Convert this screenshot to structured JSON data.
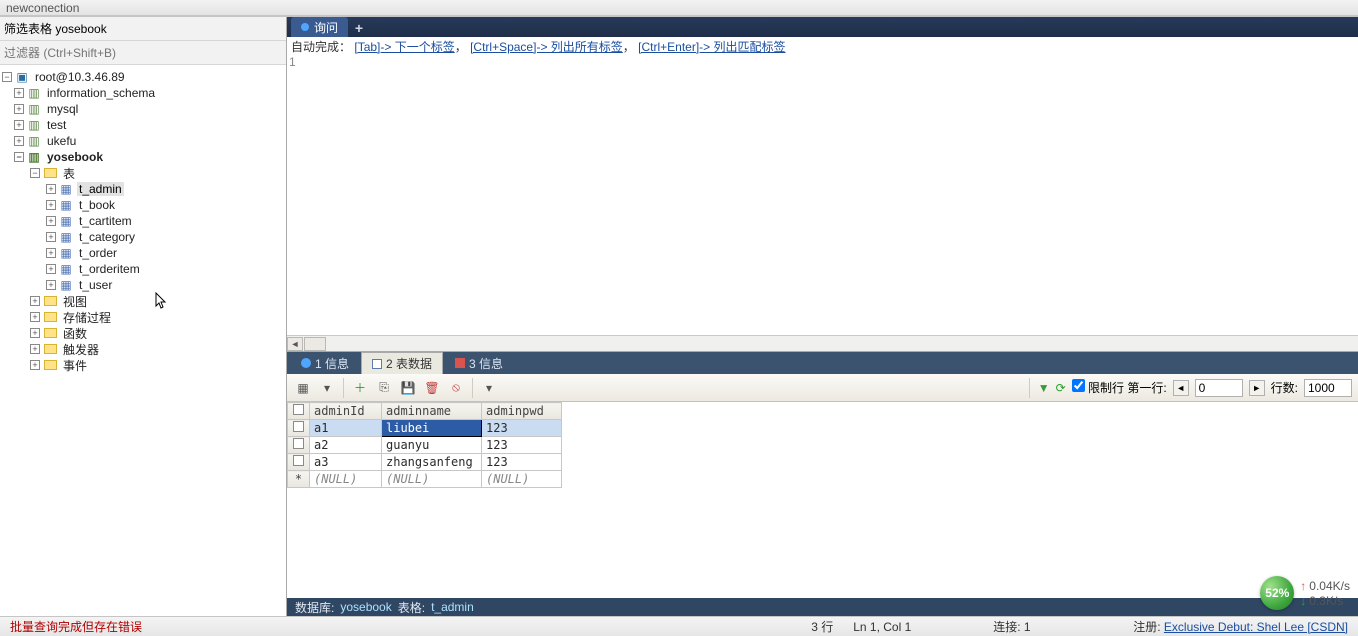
{
  "title": "newconection",
  "sidebar": {
    "filter_value": "筛选表格 yosebook",
    "filter_placeholder": "过滤器 (Ctrl+Shift+B)",
    "server": "root@10.3.46.89",
    "dbs": [
      {
        "name": "information_schema",
        "expanded": false
      },
      {
        "name": "mysql",
        "expanded": false
      },
      {
        "name": "test",
        "expanded": false
      },
      {
        "name": "ukefu",
        "expanded": false
      }
    ],
    "active_db": "yosebook",
    "tables_label": "表",
    "tables": [
      "t_admin",
      "t_book",
      "t_cartitem",
      "t_category",
      "t_order",
      "t_orderitem",
      "t_user"
    ],
    "groups": [
      "视图",
      "存储过程",
      "函数",
      "触发器",
      "事件"
    ]
  },
  "query": {
    "tab": "询问",
    "hint_prefix": "自动完成：",
    "hint_links": [
      "[Tab]-> 下一个标签",
      "[Ctrl+Space]-> 列出所有标签",
      "[Ctrl+Enter]-> 列出匹配标签"
    ],
    "line_no": "1"
  },
  "bottom_tabs": {
    "t1": "1 信息",
    "t2": "2 表数据",
    "t3": "3 信息"
  },
  "toolbar": {
    "limit_label": "限制行 第一行:",
    "first_row": "0",
    "rowcount_label": "行数:",
    "rowcount": "1000"
  },
  "grid": {
    "columns": [
      "adminId",
      "adminname",
      "adminpwd"
    ],
    "rows": [
      {
        "c": [
          "a1",
          "liubei",
          "123"
        ],
        "sel": true,
        "focus": 1
      },
      {
        "c": [
          "a2",
          "guanyu",
          "123"
        ]
      },
      {
        "c": [
          "a3",
          "zhangsanfeng",
          "123"
        ]
      }
    ],
    "null": "(NULL)"
  },
  "status_db": {
    "label": "数据库:",
    "db": "yosebook",
    "tlabel": "表格:",
    "table": "t_admin"
  },
  "status": {
    "msg": "批量查询完成但存在错误",
    "rows": "3 行",
    "pos": "Ln 1, Col 1",
    "conn": "连接: 1",
    "reg_label": "注册:",
    "reg_link": "Exclusive Debut: Shel Lee [CSDN]"
  },
  "net": {
    "pct": "52%",
    "up": "0.04K/s",
    "down": "0.3K/s"
  }
}
